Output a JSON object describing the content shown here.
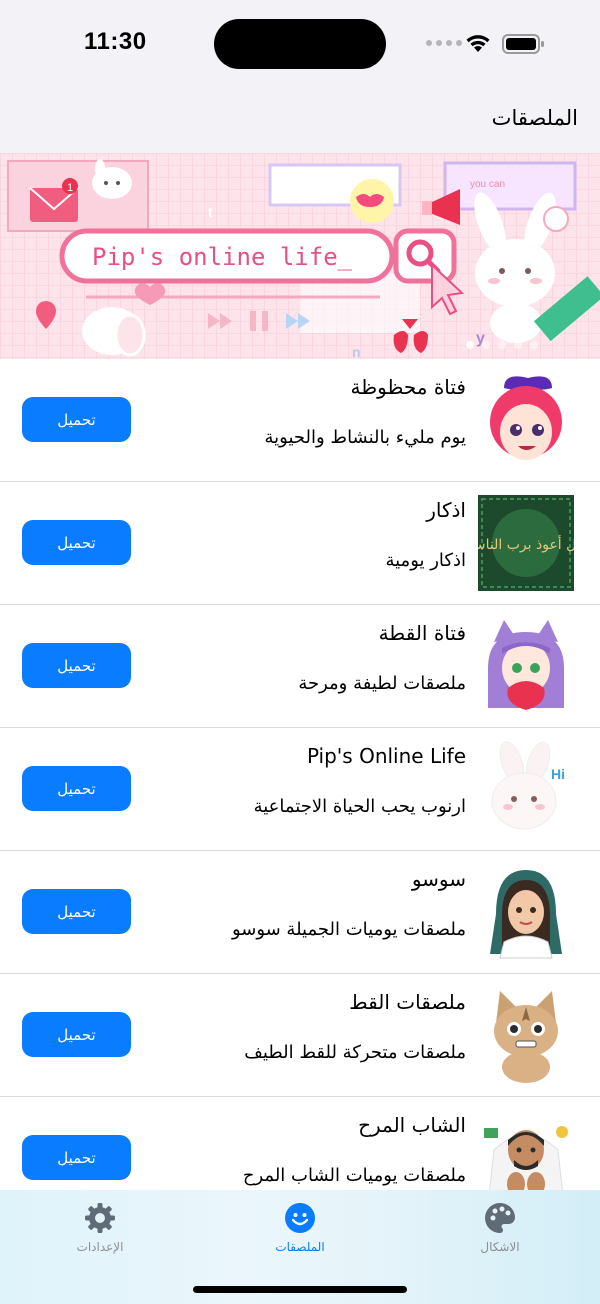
{
  "status_bar": {
    "time": "11:30"
  },
  "nav": {
    "title": "الملصقات"
  },
  "banner": {
    "text": "Pip's online life_",
    "badge": "1",
    "alt_text": "you can",
    "letters": [
      "t",
      "y",
      "n"
    ],
    "page_count": 5,
    "active_page": 0
  },
  "items": [
    {
      "title": "فتاة محظوظة",
      "subtitle": "يوم مليء بالنشاط والحيوية",
      "button": "تحميل",
      "icon": "lucky-girl-sticker-icon"
    },
    {
      "title": "اذكار",
      "subtitle": "اذكار يومية",
      "button": "تحميل",
      "icon": "azkar-calligraphy-icon",
      "calligraphy_text": "قل أعوذ برب الناس"
    },
    {
      "title": "فتاة القطة",
      "subtitle": "ملصقات لطيفة ومرحة",
      "button": "تحميل",
      "icon": "cat-girl-sticker-icon"
    },
    {
      "title": "Pip's Online Life",
      "subtitle": "ارنوب يحب الحياة الاجتماعية",
      "button": "تحميل",
      "icon": "bunny-sticker-icon",
      "bubble_text": "Hi"
    },
    {
      "title": "سوسو",
      "subtitle": "ملصقات يوميات الجميلة سوسو",
      "button": "تحميل",
      "icon": "soso-girl-sticker-icon"
    },
    {
      "title": "ملصقات القط",
      "subtitle": "ملصقات متحركة للقط الطيف",
      "button": "تحميل",
      "icon": "cat-sticker-icon"
    },
    {
      "title": "الشاب المرح",
      "subtitle": "ملصقات يوميات الشاب المرح",
      "button": "تحميل",
      "icon": "funny-guy-sticker-icon"
    }
  ],
  "tabs": [
    {
      "label": "الإعدادات",
      "icon": "gear-icon",
      "active": false
    },
    {
      "label": "الملصقات",
      "icon": "smiley-icon",
      "active": true
    },
    {
      "label": "الاشكال",
      "icon": "palette-icon",
      "active": false
    }
  ],
  "colors": {
    "accent": "#0a7cff",
    "banner_pink": "#f7c8d8",
    "tab_inactive": "#8e8e93"
  }
}
